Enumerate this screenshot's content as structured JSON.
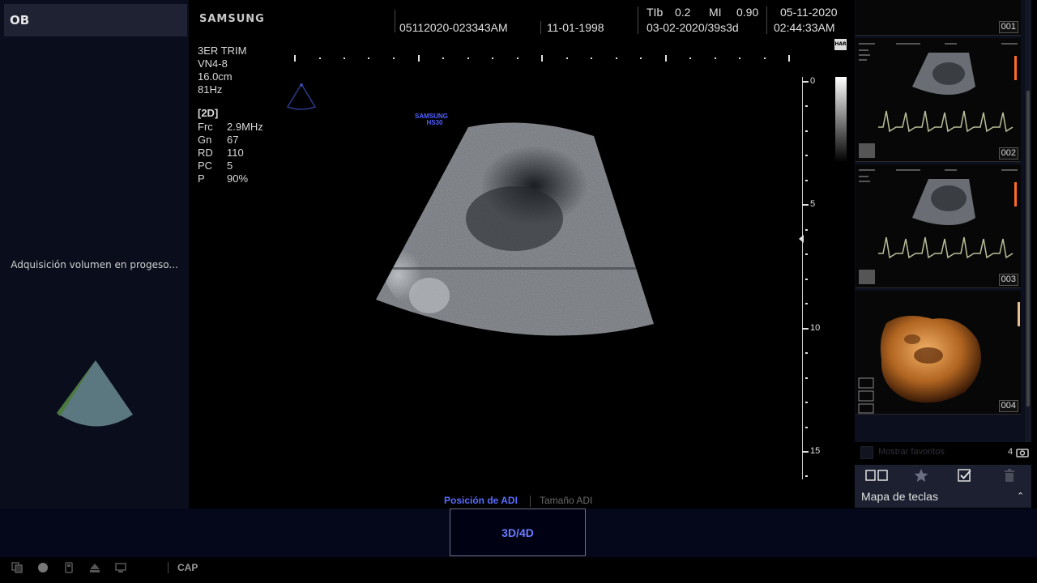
{
  "left_panel": {
    "mode_tab": "OB",
    "status_text": "Adquisición volumen en progeso..."
  },
  "header": {
    "brand": "SAMSUNG",
    "patient_id": "05112020-023343AM",
    "birth_date": "11-01-1998",
    "tib_label": "TIb",
    "tib_value": "0.2",
    "mi_label": "MI",
    "mi_value": "0.90",
    "lmp_ga": "03-02-2020/39s3d",
    "exam_date": "05-11-2020",
    "exam_time": "02:44:33AM"
  },
  "params": {
    "preset": "3ER TRIM",
    "probe": "VN4-8",
    "depth": "16.0cm",
    "frame_rate": "81Hz",
    "mode": "[2D]",
    "rows": [
      {
        "label": "Frc",
        "value": "2.9MHz"
      },
      {
        "label": "Gn",
        "value": "67"
      },
      {
        "label": "RD",
        "value": "110"
      },
      {
        "label": "PC",
        "value": "5"
      },
      {
        "label": "P",
        "value": "90%"
      }
    ]
  },
  "image": {
    "brand_line1": "SAMSUNG",
    "brand_line2": "HS30",
    "har_label": "HAR"
  },
  "depth_scale": {
    "labels": [
      "0",
      "5",
      "10",
      "15"
    ]
  },
  "bottom": {
    "adi_position": "Posición de ADI",
    "adi_size": "Tamaño ADI",
    "mode_button": "3D/4D",
    "cap_label": "CAP"
  },
  "thumbnails": [
    {
      "number": "001"
    },
    {
      "number": "002"
    },
    {
      "number": "003"
    },
    {
      "number": "004"
    }
  ],
  "favorites": {
    "label": "Mostrar favoritos",
    "count": "4"
  },
  "keymap": {
    "label": "Mapa de teclas"
  },
  "colors": {
    "accent": "#5a6cff",
    "panel_bg": "#0a0e1c",
    "toolbar_bg": "#1c2030"
  }
}
